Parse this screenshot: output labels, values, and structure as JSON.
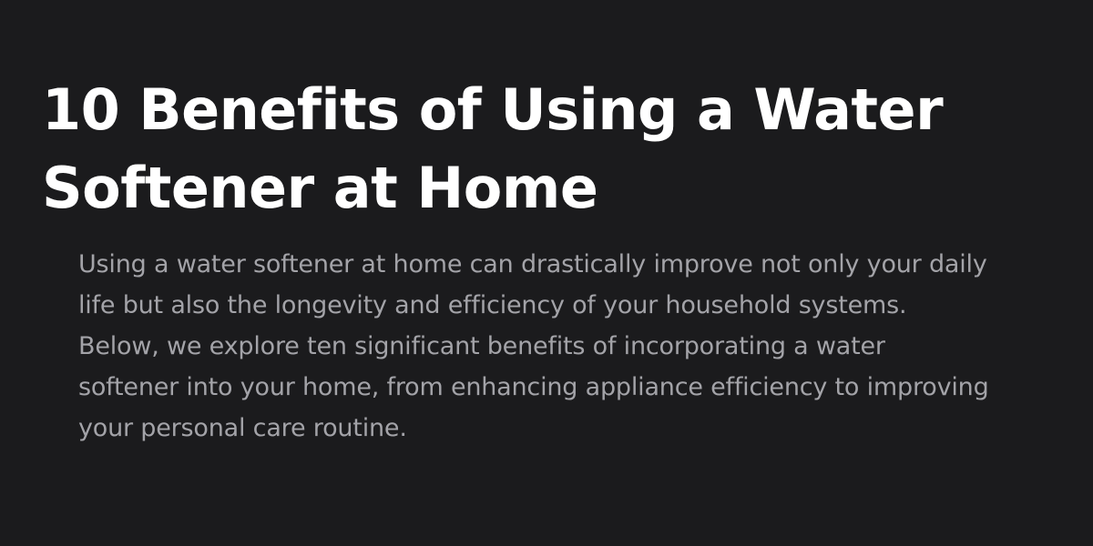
{
  "article": {
    "title_line1": "10 Benefits of Using a Water",
    "title_line2": "Softener at Home",
    "intro_lines": [
      "Using a water softener at home can drastically improve not only your daily",
      "life but also the longevity and efficiency of your household systems.",
      "Below, we explore ten significant benefits of incorporating a water",
      "softener into your home, from enhancing appliance efficiency to improving",
      "your personal care routine."
    ]
  },
  "colors": {
    "background": "#1b1b1d",
    "title": "#ffffff",
    "body_text": "#a3a3a8"
  }
}
